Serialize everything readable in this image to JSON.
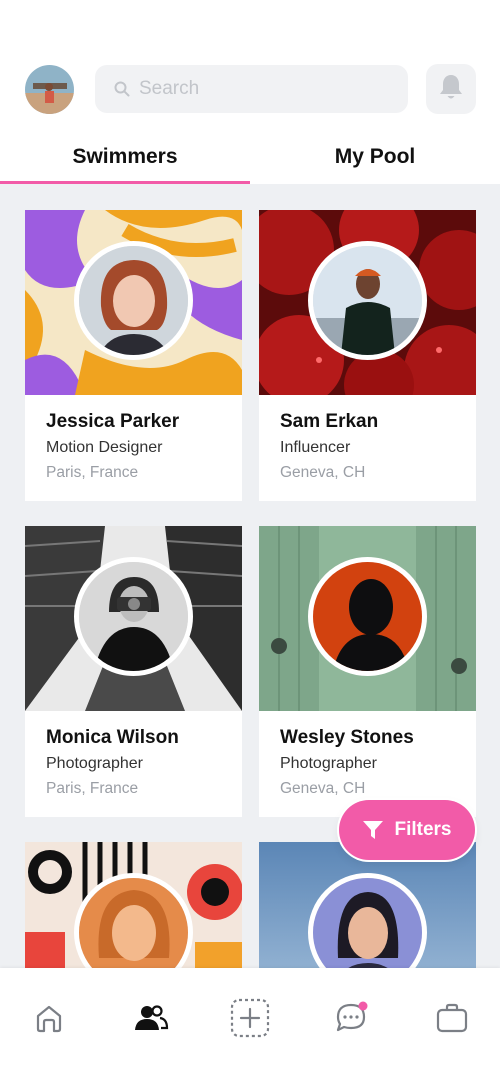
{
  "header": {
    "search_placeholder": "Search"
  },
  "tabs": [
    {
      "label": "Swimmers",
      "active": true
    },
    {
      "label": "My Pool",
      "active": false
    }
  ],
  "profiles": [
    {
      "name": "Jessica Parker",
      "role": "Motion Designer",
      "location": "Paris, France"
    },
    {
      "name": "Sam Erkan",
      "role": "Influencer",
      "location": "Geneva, CH"
    },
    {
      "name": "Monica Wilson",
      "role": "Photographer",
      "location": "Paris, France"
    },
    {
      "name": "Wesley Stones",
      "role": "Photographer",
      "location": "Geneva, CH"
    },
    {
      "name": "",
      "role": "",
      "location": ""
    },
    {
      "name": "",
      "role": "",
      "location": ""
    }
  ],
  "filters_button": {
    "label": "Filters"
  },
  "bottom_nav": {
    "items": [
      {
        "icon": "home-icon",
        "active": false
      },
      {
        "icon": "people-icon",
        "active": true
      },
      {
        "icon": "add-square-icon",
        "active": false
      },
      {
        "icon": "chat-icon",
        "active": false,
        "has_badge": true
      },
      {
        "icon": "briefcase-icon",
        "active": false
      }
    ]
  },
  "colors": {
    "accent": "#f25ba8",
    "background_grid": "#eef0f3",
    "search_bg": "#f1f2f4",
    "text_primary": "#111111",
    "text_muted": "#9a9ea5"
  }
}
